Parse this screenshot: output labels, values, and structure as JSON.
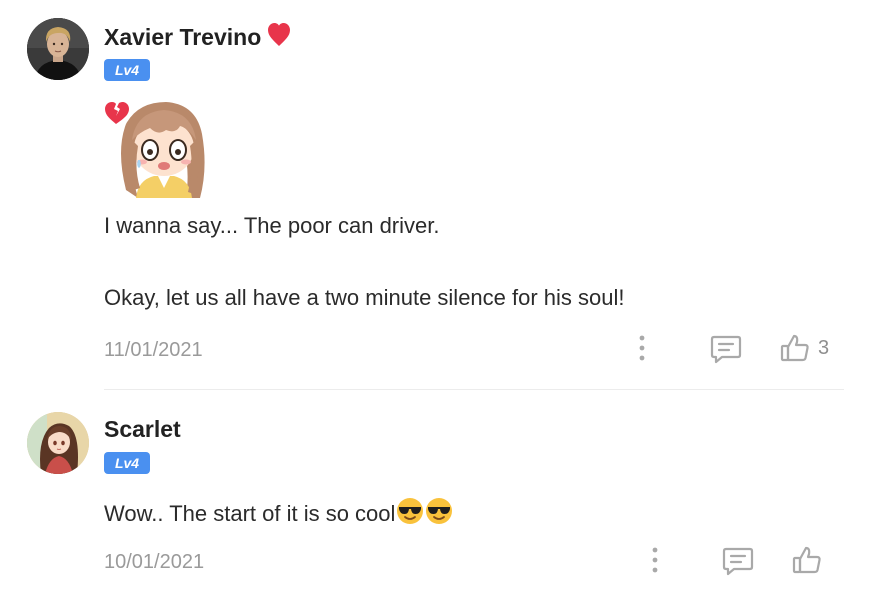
{
  "comments": [
    {
      "author": "Xavier Trevino",
      "badge": "Lv4",
      "has_heart": true,
      "paragraphs": [
        "I wanna say... The poor can driver.",
        "Okay, let us all have a two minute silence for his soul!"
      ],
      "date": "11/01/2021",
      "likes": "3",
      "sticker": "crying-anime-girl-sticker"
    },
    {
      "author": "Scarlet",
      "badge": "Lv4",
      "text": "Wow.. The start of it is so cool",
      "emojis": [
        "sunglasses-emoji",
        "sunglasses-emoji"
      ],
      "date": "10/01/2021",
      "likes": ""
    }
  ],
  "colors": {
    "badge": "#4a90f0",
    "heart": "#e8354b",
    "icon_gray": "#a9a9a9",
    "text": "#2b2b2b",
    "date": "#9a9a9a"
  }
}
